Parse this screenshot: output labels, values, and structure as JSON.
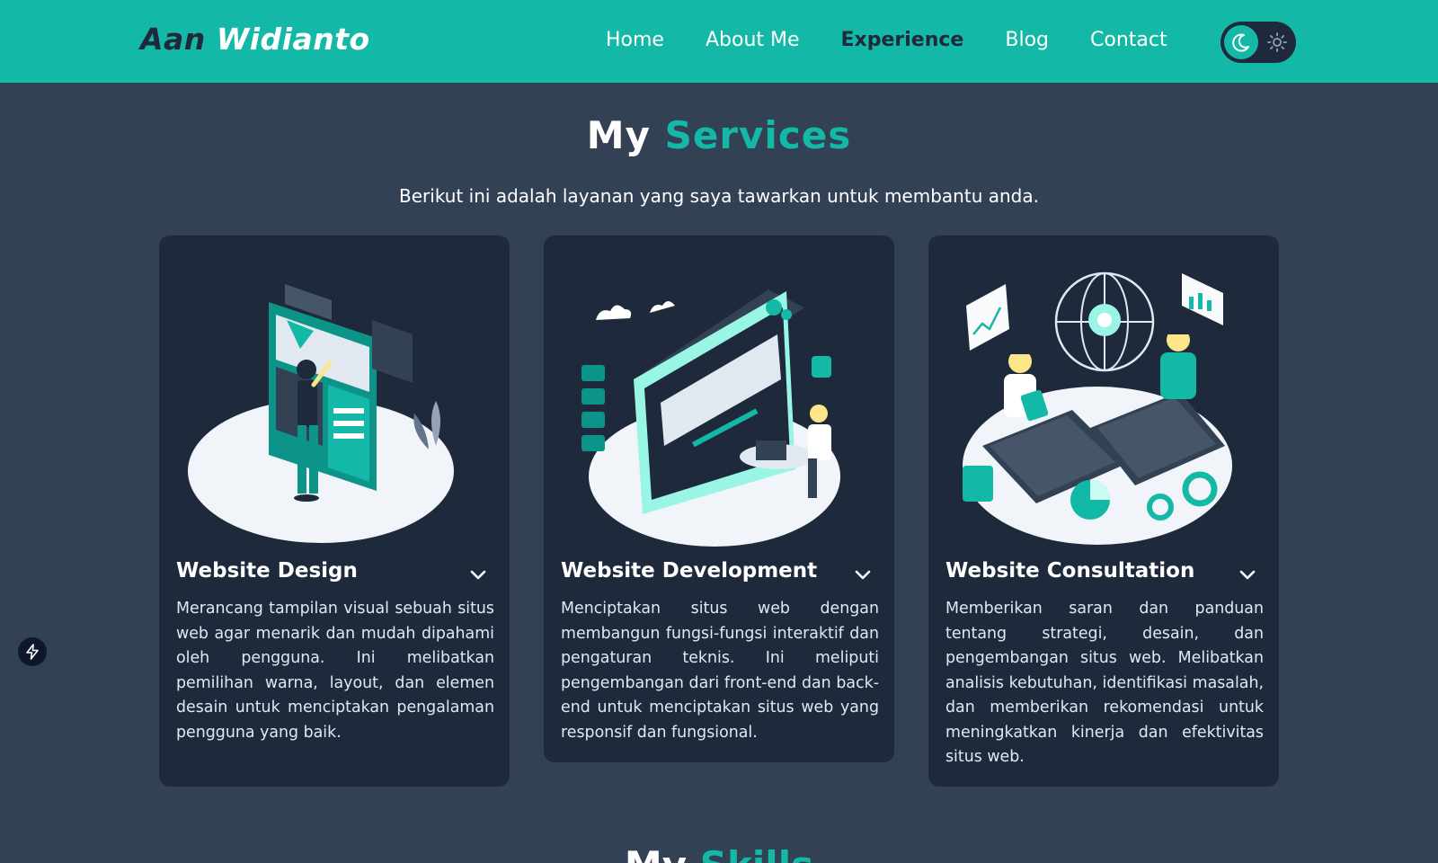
{
  "header": {
    "brand_first": "Aan",
    "brand_last": "Widianto",
    "nav": [
      {
        "label": "Home"
      },
      {
        "label": "About Me"
      },
      {
        "label": "Experience"
      },
      {
        "label": "Blog"
      },
      {
        "label": "Contact"
      }
    ],
    "active_nav": "Experience",
    "theme_toggle": {
      "dark_icon": "moon-icon",
      "light_icon": "sun-icon"
    }
  },
  "services": {
    "title_first": "My",
    "title_accent": "Services",
    "subtitle": "Berikut ini adalah layanan yang saya tawarkan untuk membantu anda.",
    "cards": [
      {
        "title": "Website Design",
        "illustration": "web-design-illustration",
        "description": "Merancang tampilan visual sebuah situs web agar menarik dan mudah dipahami oleh pengguna. Ini melibatkan pemilihan warna, layout, dan elemen desain untuk menciptakan pengalaman pengguna yang baik."
      },
      {
        "title": "Website Development",
        "illustration": "web-development-illustration",
        "description": "Menciptakan situs web dengan membangun fungsi-fungsi interaktif dan pengaturan teknis. Ini meliputi pengembangan dari front-end dan back-end untuk menciptakan situs web yang responsif dan fungsional."
      },
      {
        "title": "Website Consultation",
        "illustration": "web-consultation-illustration",
        "description": "Memberikan saran dan panduan tentang strategi, desain, dan pengembangan situs web. Melibatkan analisis kebutuhan, identifikasi masalah, dan memberikan rekomendasi untuk meningkatkan kinerja dan efektivitas situs web."
      }
    ]
  },
  "next_section": {
    "title_first": "My",
    "title_accent": "Skills"
  },
  "colors": {
    "accent": "#14b8a6",
    "page_bg": "#334155",
    "card_bg": "#1e293b",
    "dark_text": "#1e293b"
  }
}
